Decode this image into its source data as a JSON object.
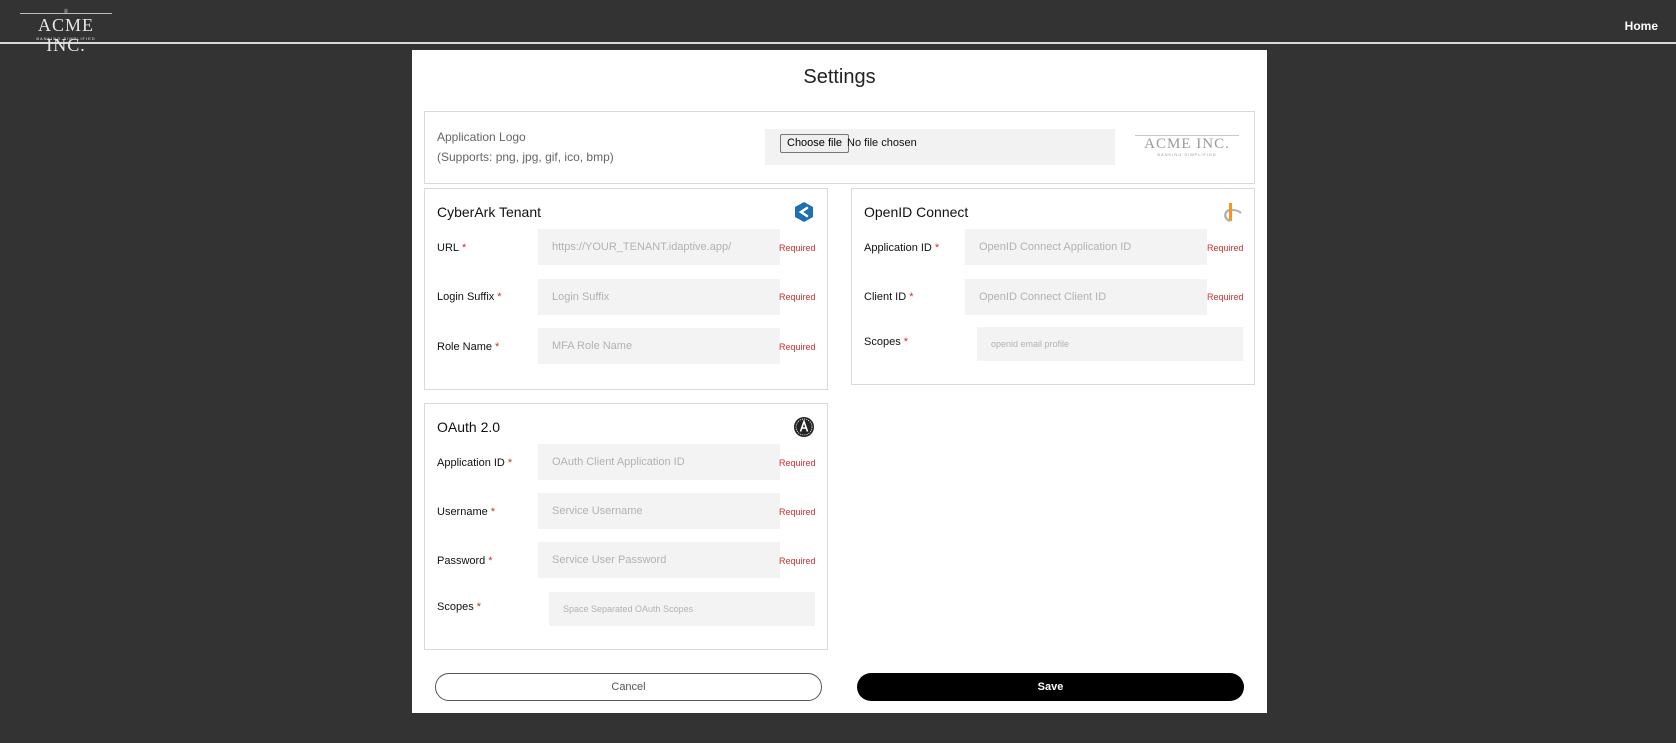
{
  "brand": {
    "name": "ACME INC.",
    "tagline": "BANKING SIMPLIFIED",
    "crown": "♕"
  },
  "nav": {
    "home_label": "Home"
  },
  "page": {
    "title": "Settings"
  },
  "logo": {
    "label": "Application Logo",
    "supports": "(Supports: png, jpg, gif, ico, bmp)",
    "choose_file_label": "Choose file",
    "file_status": "No file chosen",
    "preview_name": "ACME INC.",
    "preview_tagline": "BANKING SIMPLIFIED"
  },
  "required_star": "*",
  "required_text": "Required",
  "cyberark": {
    "title": "CyberArk Tenant",
    "icon": "cyberark-icon",
    "fields": [
      {
        "label": "URL",
        "placeholder": "https://YOUR_TENANT.idaptive.app/"
      },
      {
        "label": "Login Suffix",
        "placeholder": "Login Suffix"
      },
      {
        "label": "Role Name",
        "placeholder": "MFA Role Name"
      }
    ]
  },
  "oidc": {
    "title": "OpenID Connect",
    "icon": "openid-icon",
    "fields": [
      {
        "label": "Application ID",
        "placeholder": "OpenID Connect Application ID"
      },
      {
        "label": "Client ID",
        "placeholder": "OpenID Connect Client ID"
      },
      {
        "label": "Scopes",
        "placeholder": "openid email profile"
      }
    ]
  },
  "oauth": {
    "title": "OAuth 2.0",
    "icon": "oauth-icon",
    "fields": [
      {
        "label": "Application ID",
        "placeholder": "OAuth Client Application ID"
      },
      {
        "label": "Username",
        "placeholder": "Service Username"
      },
      {
        "label": "Password",
        "placeholder": "Service User Password"
      },
      {
        "label": "Scopes",
        "placeholder": "Space Separated OAuth Scopes"
      }
    ]
  },
  "actions": {
    "cancel_label": "Cancel",
    "save_label": "Save"
  },
  "colors": {
    "background": "#333333",
    "required": "#d32f2f",
    "cyberark_blue": "#1f6fb5",
    "openid_orange": "#f7931e",
    "save_button": "#000000"
  }
}
